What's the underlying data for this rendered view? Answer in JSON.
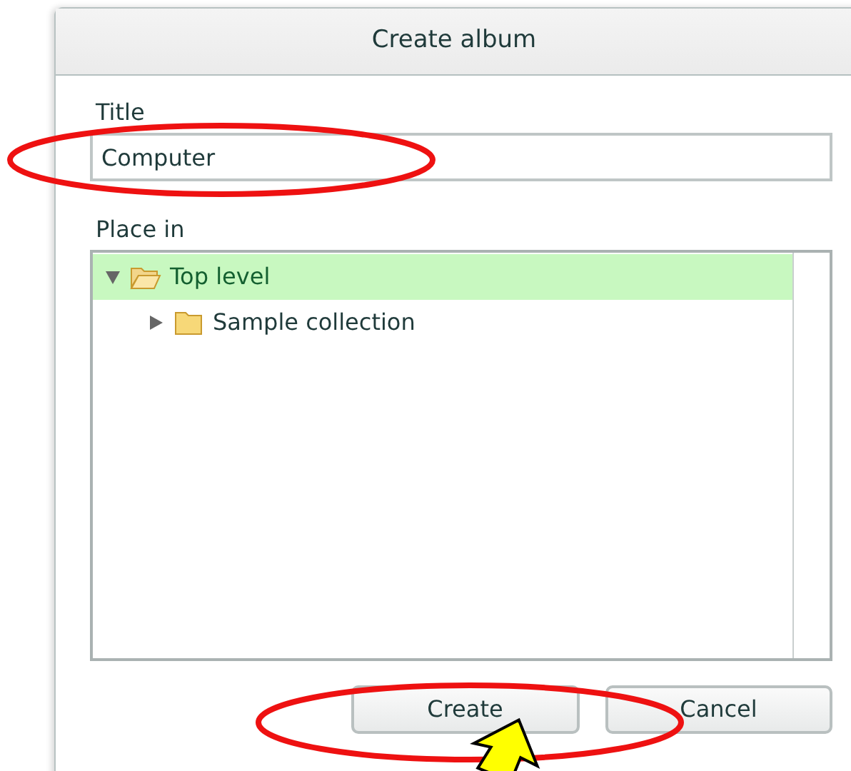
{
  "dialog": {
    "title": "Create album",
    "title_field": {
      "label": "Title",
      "value": "Computer"
    },
    "place_in": {
      "label": "Place in",
      "tree": [
        {
          "label": "Top level",
          "expanded": true,
          "selected": true,
          "children": [
            {
              "label": "Sample collection",
              "expanded": false,
              "selected": false
            }
          ]
        }
      ]
    },
    "buttons": [
      {
        "label": "Create"
      },
      {
        "label": "Cancel"
      }
    ]
  },
  "annotations": [
    {
      "kind": "ellipse"
    },
    {
      "kind": "ellipse"
    },
    {
      "kind": "arrow"
    }
  ]
}
